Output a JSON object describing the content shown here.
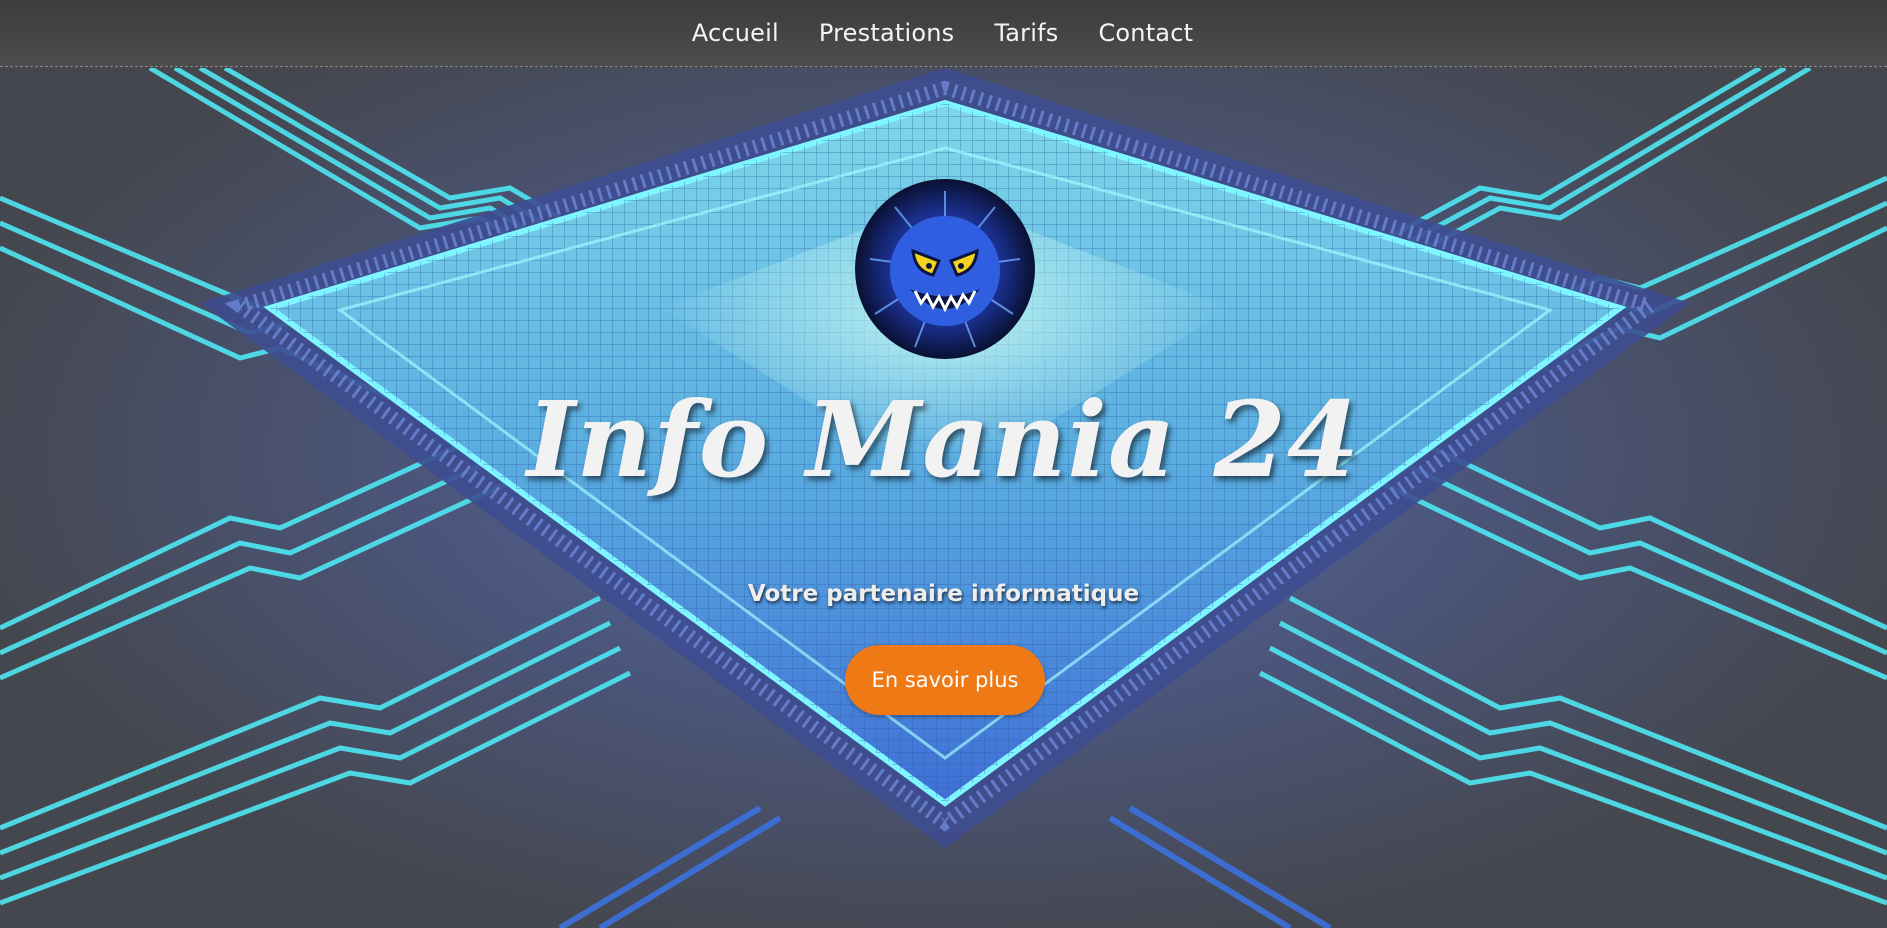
{
  "nav": {
    "items": [
      {
        "label": "Accueil"
      },
      {
        "label": "Prestations"
      },
      {
        "label": "Tarifs"
      },
      {
        "label": "Contact"
      }
    ]
  },
  "hero": {
    "logo_icon": "blue-monster-icon",
    "title": "Info Mania 24",
    "subtitle": "Votre partenaire informatique",
    "cta_label": "En savoir plus",
    "background_icon": "cpu-chip-circuit-image"
  },
  "colors": {
    "nav_bg": "#444446",
    "cta": "#ef7a15",
    "circuit_cyan": "#4fe6f2",
    "circuit_blue": "#3b74e6",
    "text": "#f2f2f2"
  }
}
